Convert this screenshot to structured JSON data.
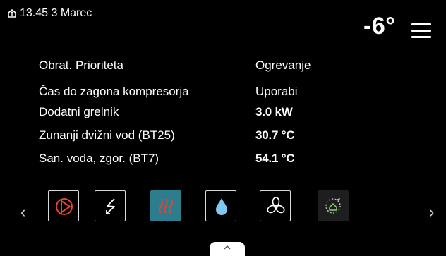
{
  "status": {
    "datetime": "13.45 3 Marec",
    "icon": "home-upload-icon"
  },
  "outdoor_temp": "-6°",
  "menu_icon": "hamburger-menu-icon",
  "info_rows": [
    {
      "label": "Obrat. Prioriteta",
      "value": "Ogrevanje",
      "bold": false
    },
    {
      "label": "Čas do zagona kompresorja",
      "value": "Uporabi",
      "bold": false
    },
    {
      "label": "Dodatni grelnik",
      "value": "3.0 kW",
      "bold": true
    },
    {
      "label": "Zunanji dvižni vod (BT25)",
      "value": "30.7 °C",
      "bold": true
    },
    {
      "label": "San. voda, zgor. (BT7)",
      "value": "54.1 °C",
      "bold": true
    }
  ],
  "nav": {
    "prev": "‹",
    "next": "›"
  },
  "tiles": [
    {
      "icon": "compressor-icon",
      "state": "normal"
    },
    {
      "icon": "electric-heater-icon",
      "state": "normal"
    },
    {
      "icon": "heating-icon",
      "state": "active"
    },
    {
      "icon": "hot-water-drop-icon",
      "state": "normal"
    },
    {
      "icon": "ventilation-fan-icon",
      "state": "normal"
    },
    {
      "icon": "smart-home-cycle-icon",
      "state": "inactive"
    }
  ],
  "colors": {
    "background": "#000000",
    "active_tile": "#2d7d8e",
    "compressor_red": "#e5452f",
    "heating_red": "#e5452f",
    "water_blue": "#7ec8f2",
    "smart_home_green": "#8fd16a"
  },
  "pull_up_tab_icon": "chevron-up-icon"
}
